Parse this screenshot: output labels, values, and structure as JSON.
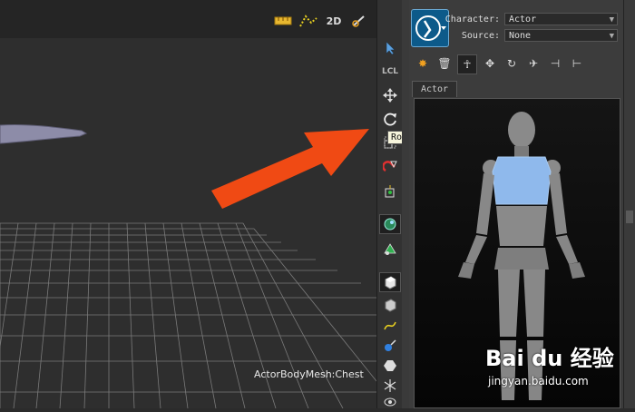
{
  "viewport": {
    "mesh_label": "ActorBodyMesh:Chest",
    "top_icons": [
      "ruler-icon",
      "path-icon",
      "2d-view-icon",
      "link-icon"
    ],
    "twod_label": "2D"
  },
  "toolbar": {
    "lcl_label": "LCL",
    "tooltip": "Rotate"
  },
  "panel": {
    "character_label": "Character:",
    "character_value": "Actor",
    "source_label": "Source:",
    "source_value": "None",
    "tab_label": "Actor"
  },
  "watermark": {
    "main": "Bai du 经验",
    "sub": "jingyan.baidu.com"
  },
  "colors": {
    "arrow": "#f04a14",
    "chest_highlight": "#8fb9ec",
    "mannequin": "#8a8a8a"
  }
}
